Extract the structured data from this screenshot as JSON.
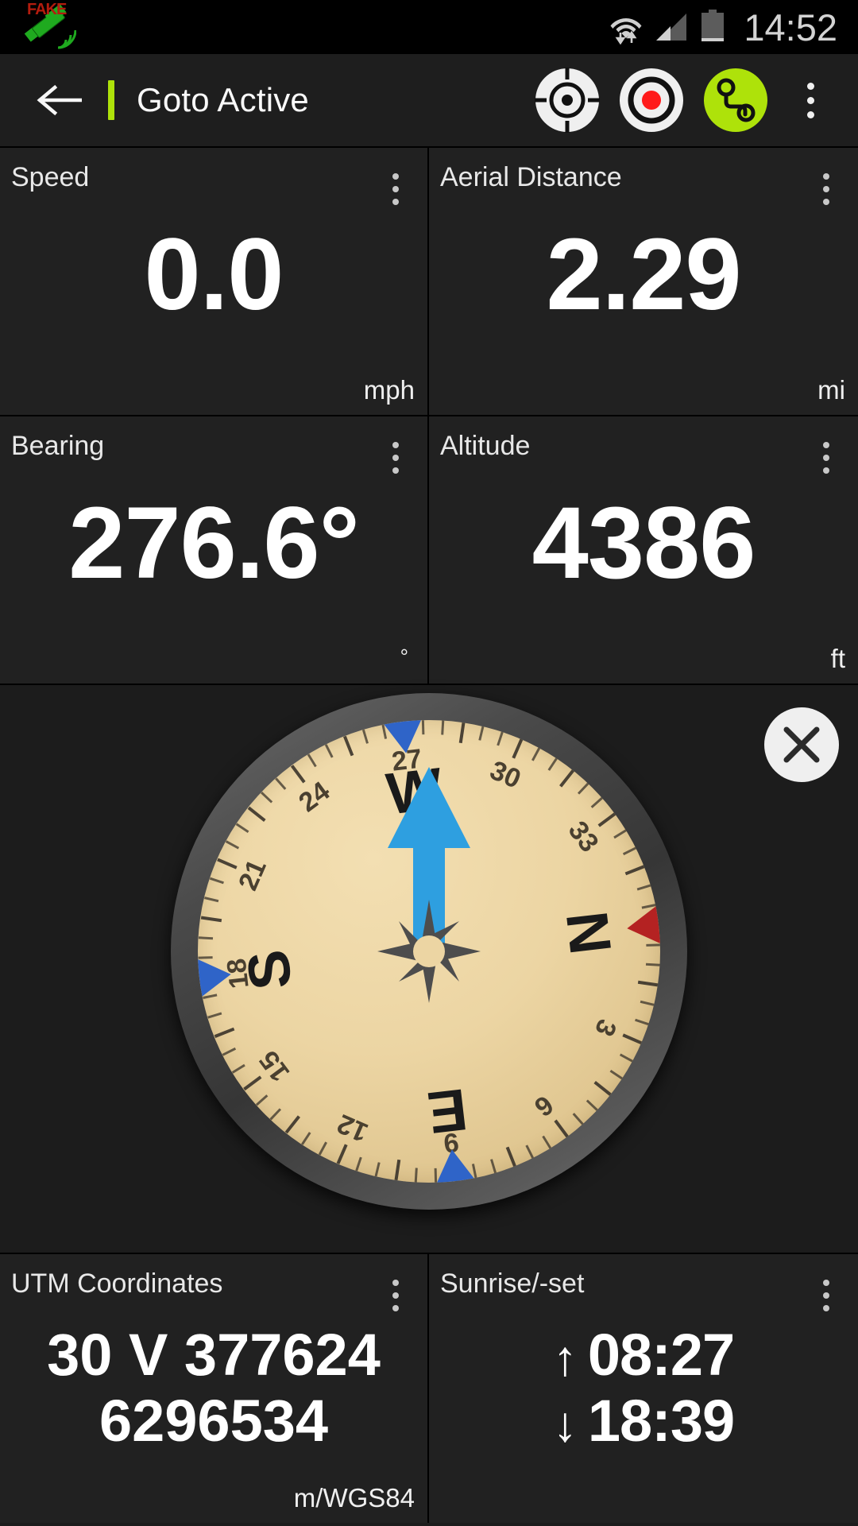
{
  "status_bar": {
    "mock_location_label": "FAKE",
    "mock_location_icon": "gps-satellite-icon",
    "wifi_icon": "wifi-transfer-icon",
    "signal_icon": "cellular-signal-icon",
    "battery_icon": "battery-icon",
    "clock": "14:52"
  },
  "action_bar": {
    "back_icon": "back-arrow-icon",
    "accent_color": "#aee20a",
    "title": "Goto Active",
    "actions": [
      {
        "name": "crosshair-target-icon",
        "label": "Center on location"
      },
      {
        "name": "record-icon",
        "label": "Record track"
      },
      {
        "name": "route-waypoints-icon",
        "label": "Route"
      }
    ],
    "overflow_label": "More options"
  },
  "dashboard": {
    "cards": [
      {
        "title": "Speed",
        "value": "0.0",
        "unit": "mph"
      },
      {
        "title": "Aerial Distance",
        "value": "2.29",
        "unit": "mi"
      },
      {
        "title": "Bearing",
        "value": "276.6°",
        "unit": "°"
      },
      {
        "title": "Altitude",
        "value": "4386",
        "unit": "ft"
      }
    ],
    "bottom_cards": [
      {
        "title": "UTM Coordinates",
        "line1": "30 V 377624",
        "line2": "6296534",
        "unit": "m/WGS84"
      },
      {
        "title": "Sunrise/-set",
        "sunrise_arrow": "↑",
        "sunrise": "08:27",
        "sunset_arrow": "↓",
        "sunset": "18:39"
      }
    ],
    "menu_icon": "overflow-menu-icon"
  },
  "compass": {
    "close_icon": "close-icon",
    "bearing_deg": 276.6,
    "dial_color": "#ecd5a3",
    "bezel_color": "#4a4a4a",
    "needle_color": "#2e9fe0",
    "north_marker_color": "#b42222",
    "marker_color": "#2f64c8",
    "cardinals": [
      {
        "label": "N",
        "deg": 0
      },
      {
        "label": "E",
        "deg": 90
      },
      {
        "label": "S",
        "deg": 180
      },
      {
        "label": "W",
        "deg": 270
      }
    ],
    "tick_numbers": [
      3,
      6,
      9,
      12,
      15,
      18,
      21,
      24,
      27,
      30,
      33
    ]
  }
}
